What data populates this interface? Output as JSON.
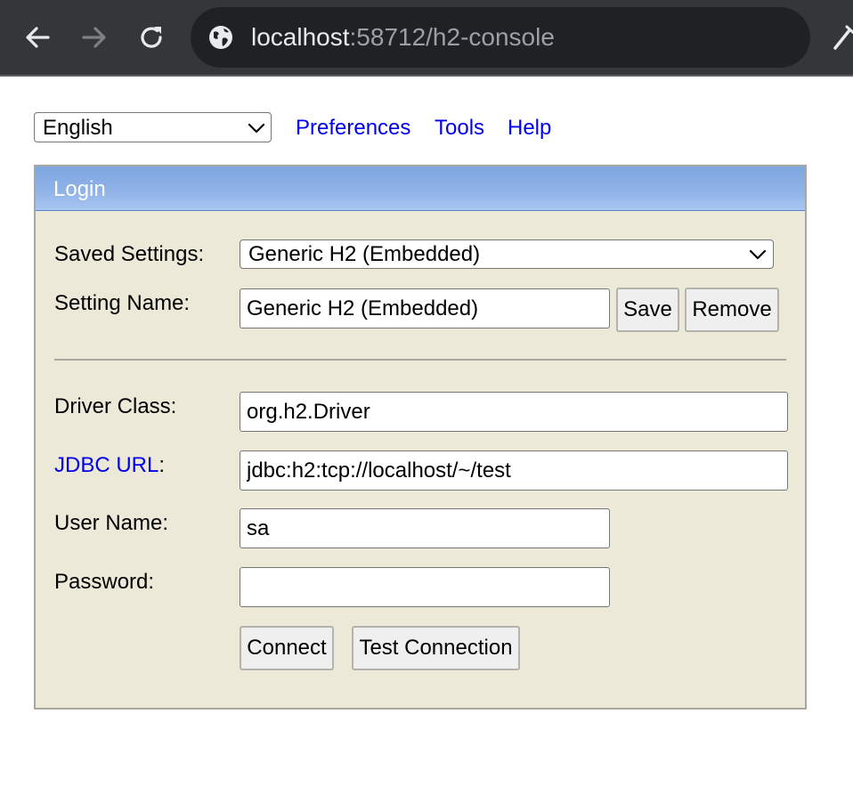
{
  "browser": {
    "url_host": "localhost",
    "url_rest": ":58712/h2-console",
    "icons": [
      "back-arrow-icon",
      "forward-arrow-icon",
      "reload-icon",
      "globe-icon",
      "extension-icon"
    ]
  },
  "topnav": {
    "language": "English",
    "links": [
      "Preferences",
      "Tools",
      "Help"
    ]
  },
  "login": {
    "title": "Login",
    "saved_settings_label": "Saved Settings:",
    "saved_settings_value": "Generic H2 (Embedded)",
    "setting_name_label": "Setting Name:",
    "setting_name_value": "Generic H2 (Embedded)",
    "save_label": "Save",
    "remove_label": "Remove",
    "driver_class_label": "Driver Class:",
    "driver_class_value": "org.h2.Driver",
    "jdbc_url_link": "JDBC URL",
    "jdbc_url_colon": ":",
    "jdbc_url_value": "jdbc:h2:tcp://localhost/~/test",
    "user_name_label": "User Name:",
    "user_name_value": "sa",
    "password_label": "Password:",
    "password_value": "",
    "connect_label": "Connect",
    "test_connection_label": "Test Connection"
  },
  "colors": {
    "toolbar": "#35363a",
    "omnibox": "#202124",
    "link": "#0000ee",
    "panel_bg": "#ece9d8",
    "header_blue": "#8fb2e7"
  }
}
